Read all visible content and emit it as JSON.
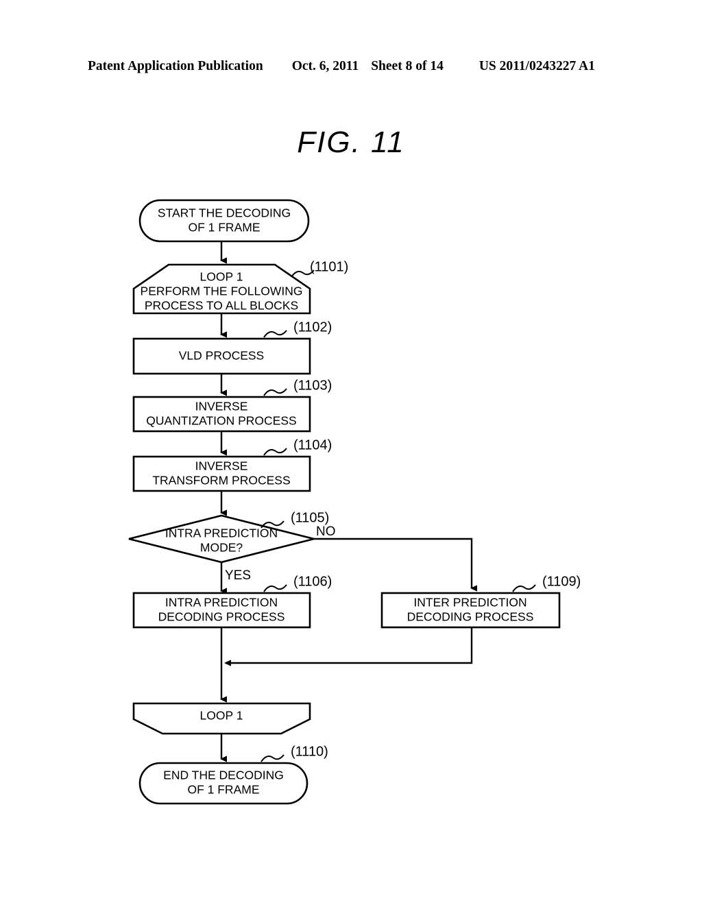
{
  "header": {
    "publication": "Patent Application Publication",
    "date": "Oct. 6, 2011",
    "sheet": "Sheet 8 of 14",
    "doc_number": "US 2011/0243227 A1"
  },
  "figure": {
    "title": "FIG.  11"
  },
  "chart_data": {
    "type": "diagram",
    "diagram_kind": "flowchart",
    "title": "FIG.  11",
    "nodes": [
      {
        "id": "start",
        "shape": "terminator",
        "ref": null,
        "lines": [
          "START THE DECODING",
          "OF 1 FRAME"
        ]
      },
      {
        "id": "loop_start",
        "shape": "loop-start",
        "ref": "(1101)",
        "lines": [
          "LOOP 1",
          "PERFORM THE FOLLOWING",
          "PROCESS TO ALL BLOCKS"
        ]
      },
      {
        "id": "vld",
        "shape": "process",
        "ref": "(1102)",
        "lines": [
          "VLD PROCESS"
        ]
      },
      {
        "id": "inv_quant",
        "shape": "process",
        "ref": "(1103)",
        "lines": [
          "INVERSE",
          "QUANTIZATION PROCESS"
        ]
      },
      {
        "id": "inv_transform",
        "shape": "process",
        "ref": "(1104)",
        "lines": [
          "INVERSE",
          "TRANSFORM PROCESS"
        ]
      },
      {
        "id": "decision",
        "shape": "decision",
        "ref": "(1105)",
        "lines": [
          "INTRA PREDICTION",
          "MODE?"
        ]
      },
      {
        "id": "intra_decode",
        "shape": "process",
        "ref": "(1106)",
        "lines": [
          "INTRA PREDICTION",
          "DECODING PROCESS"
        ]
      },
      {
        "id": "inter_decode",
        "shape": "process",
        "ref": "(1109)",
        "lines": [
          "INTER PREDICTION",
          "DECODING PROCESS"
        ]
      },
      {
        "id": "loop_end",
        "shape": "loop-end",
        "ref": null,
        "lines": [
          "LOOP 1"
        ]
      },
      {
        "id": "end",
        "shape": "terminator",
        "ref": "(1110)",
        "lines": [
          "END THE DECODING",
          "OF 1 FRAME"
        ]
      }
    ],
    "edges": [
      {
        "from": "start",
        "to": "loop_start",
        "label": ""
      },
      {
        "from": "loop_start",
        "to": "vld",
        "label": ""
      },
      {
        "from": "vld",
        "to": "inv_quant",
        "label": ""
      },
      {
        "from": "inv_quant",
        "to": "inv_transform",
        "label": ""
      },
      {
        "from": "inv_transform",
        "to": "decision",
        "label": ""
      },
      {
        "from": "decision",
        "to": "intra_decode",
        "label": "YES"
      },
      {
        "from": "decision",
        "to": "inter_decode",
        "label": "NO"
      },
      {
        "from": "inter_decode",
        "to": "intra_decode_merge",
        "label": ""
      },
      {
        "from": "intra_decode",
        "to": "loop_end",
        "label": ""
      },
      {
        "from": "loop_end",
        "to": "end",
        "label": ""
      }
    ],
    "branch_labels": {
      "yes": "YES",
      "no": "NO"
    }
  }
}
